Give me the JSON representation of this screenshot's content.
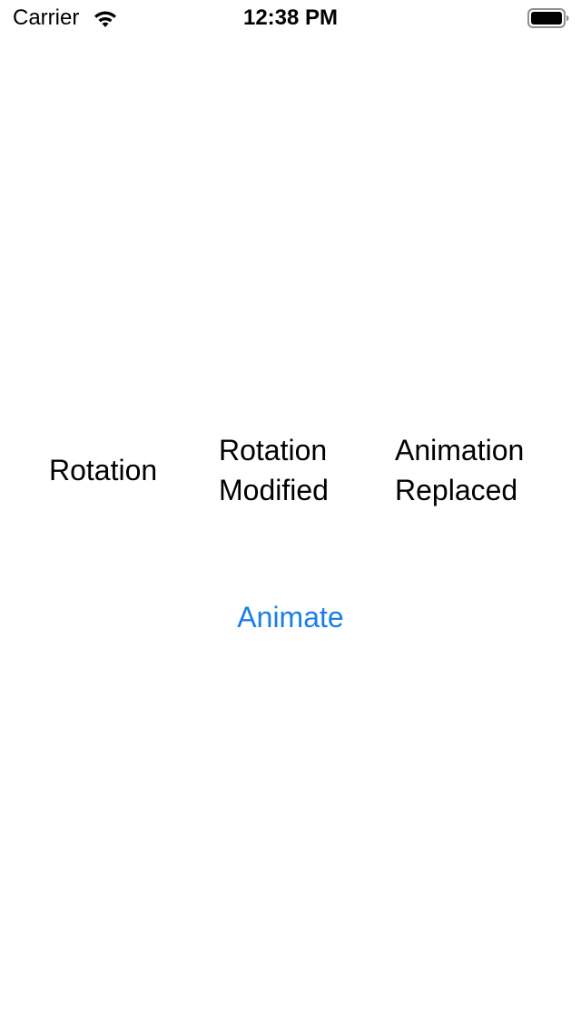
{
  "status_bar": {
    "carrier": "Carrier",
    "time": "12:38 PM",
    "wifi_icon": "wifi-icon",
    "battery_icon": "battery-full-icon"
  },
  "labels": {
    "rotation": "Rotation",
    "rotation_modified": "Rotation\nModified",
    "animation_replaced": "Animation\nReplaced"
  },
  "animate_button": {
    "label": "Animate",
    "color": "#1a7fe6"
  }
}
